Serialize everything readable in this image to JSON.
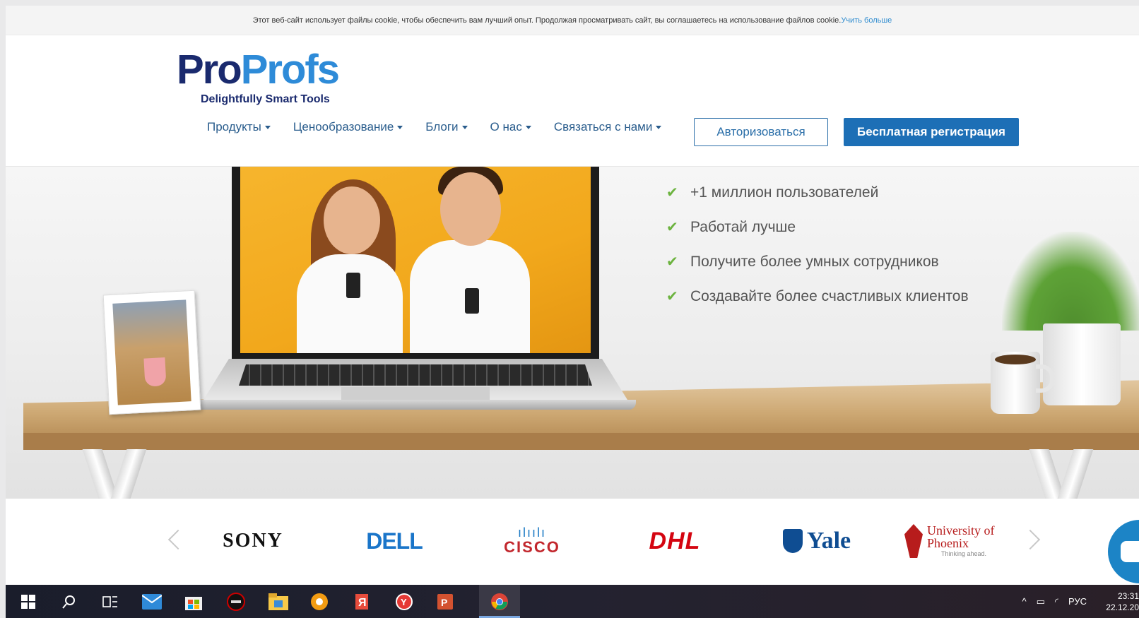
{
  "cookie": {
    "text": "Этот веб-сайт использует файлы cookie, чтобы обеспечить вам лучший опыт. Продолжая просматривать сайт, вы соглашаетесь на использование файлов cookie.",
    "link": "Учить больше"
  },
  "logo": {
    "part1": "Pro",
    "part2": "Profs",
    "tagline": "Delightfully Smart Tools"
  },
  "nav": {
    "items": [
      "Продукты",
      "Ценообразование",
      "Блоги",
      "О нас",
      "Связаться с нами"
    ],
    "login": "Авторизоваться",
    "signup": "Бесплатная регистрация"
  },
  "hero": {
    "benefits": [
      "+1 миллион пользователей",
      "Работай лучше",
      "Получите более умных сотрудников",
      "Создавайте более счастливых клиентов"
    ]
  },
  "clients": {
    "sony": "SONY",
    "dell": "DELL",
    "cisco_bars": "ılıılı",
    "cisco": "CISCO",
    "dhl": "DHL",
    "yale": "Yale",
    "uop_line1": "University of",
    "uop_line2": "Phoenix",
    "uop_line3": "Thinking ahead."
  },
  "taskbar": {
    "lang": "РУС",
    "time": "23:31",
    "date": "22.12.20"
  },
  "colors": {
    "brand_dark": "#1a2a6e",
    "brand_blue": "#2e8bd8",
    "signup_bg": "#1d6fb6",
    "check_green": "#6cb33f"
  }
}
